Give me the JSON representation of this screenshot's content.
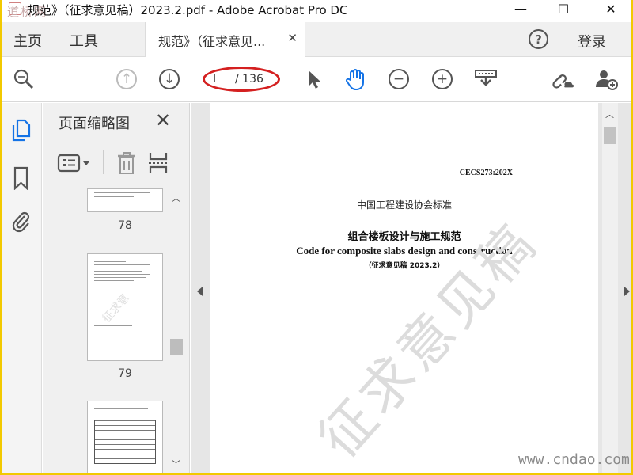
{
  "titlebar": {
    "title": "规范》（征求意见稿）2023.2.pdf - Adobe Acrobat Pro DC",
    "watermark": "道桥网",
    "minimize": "—",
    "maximize": "☐",
    "close": "✕"
  },
  "menubar": {
    "home": "主页",
    "tools": "工具",
    "doc_tab": "规范》（征求意见...",
    "doc_tab_close": "✕",
    "help": "?",
    "login": "登录"
  },
  "toolbar": {
    "current_page": "I",
    "total_pages": "/ 136"
  },
  "thumbnails": {
    "header": "页面缩略图",
    "close": "✕",
    "pages": [
      {
        "label": "78"
      },
      {
        "label": "79"
      }
    ]
  },
  "document": {
    "code": "CECS273:202X",
    "org": "中国工程建设协会标准",
    "title_cn": "组合楼板设计与施工规范",
    "title_en": "Code for composite slabs design and construction",
    "subtitle": "（征求意见稿 2023.2）",
    "stamp": "征求意见稿"
  },
  "site_watermark": "www.cndao.com",
  "colors": {
    "border": "#f2c900",
    "accent_blue": "#1473e6",
    "annotation_ring": "#d42020"
  }
}
